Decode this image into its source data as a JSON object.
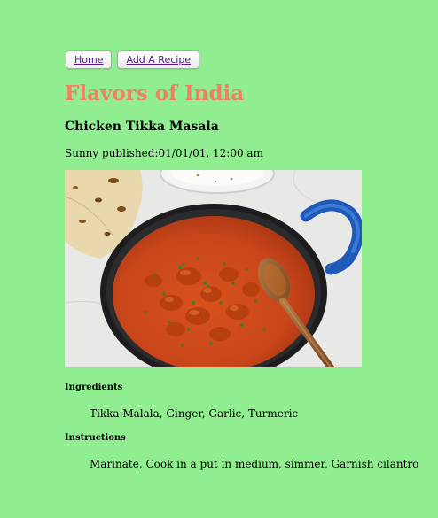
{
  "nav": {
    "home_label": "Home",
    "add_recipe_label": "Add A Recipe"
  },
  "site": {
    "title": "Flavors of India"
  },
  "recipe": {
    "title": "Chicken Tikka Masala",
    "author": "Sunny",
    "published_label": "published:",
    "published_date": "01/01/01, 12:00 am",
    "ingredients_heading": "Ingredients",
    "ingredients": "Tikka Malala, Ginger, Garlic, Turmeric",
    "instructions_heading": "Instructions",
    "instructions": "Marinate, Cook in a put in medium, simmer, Garnish cilantro"
  },
  "colors": {
    "background": "#90ee90",
    "title": "#f08060",
    "link": "#551a8b"
  }
}
